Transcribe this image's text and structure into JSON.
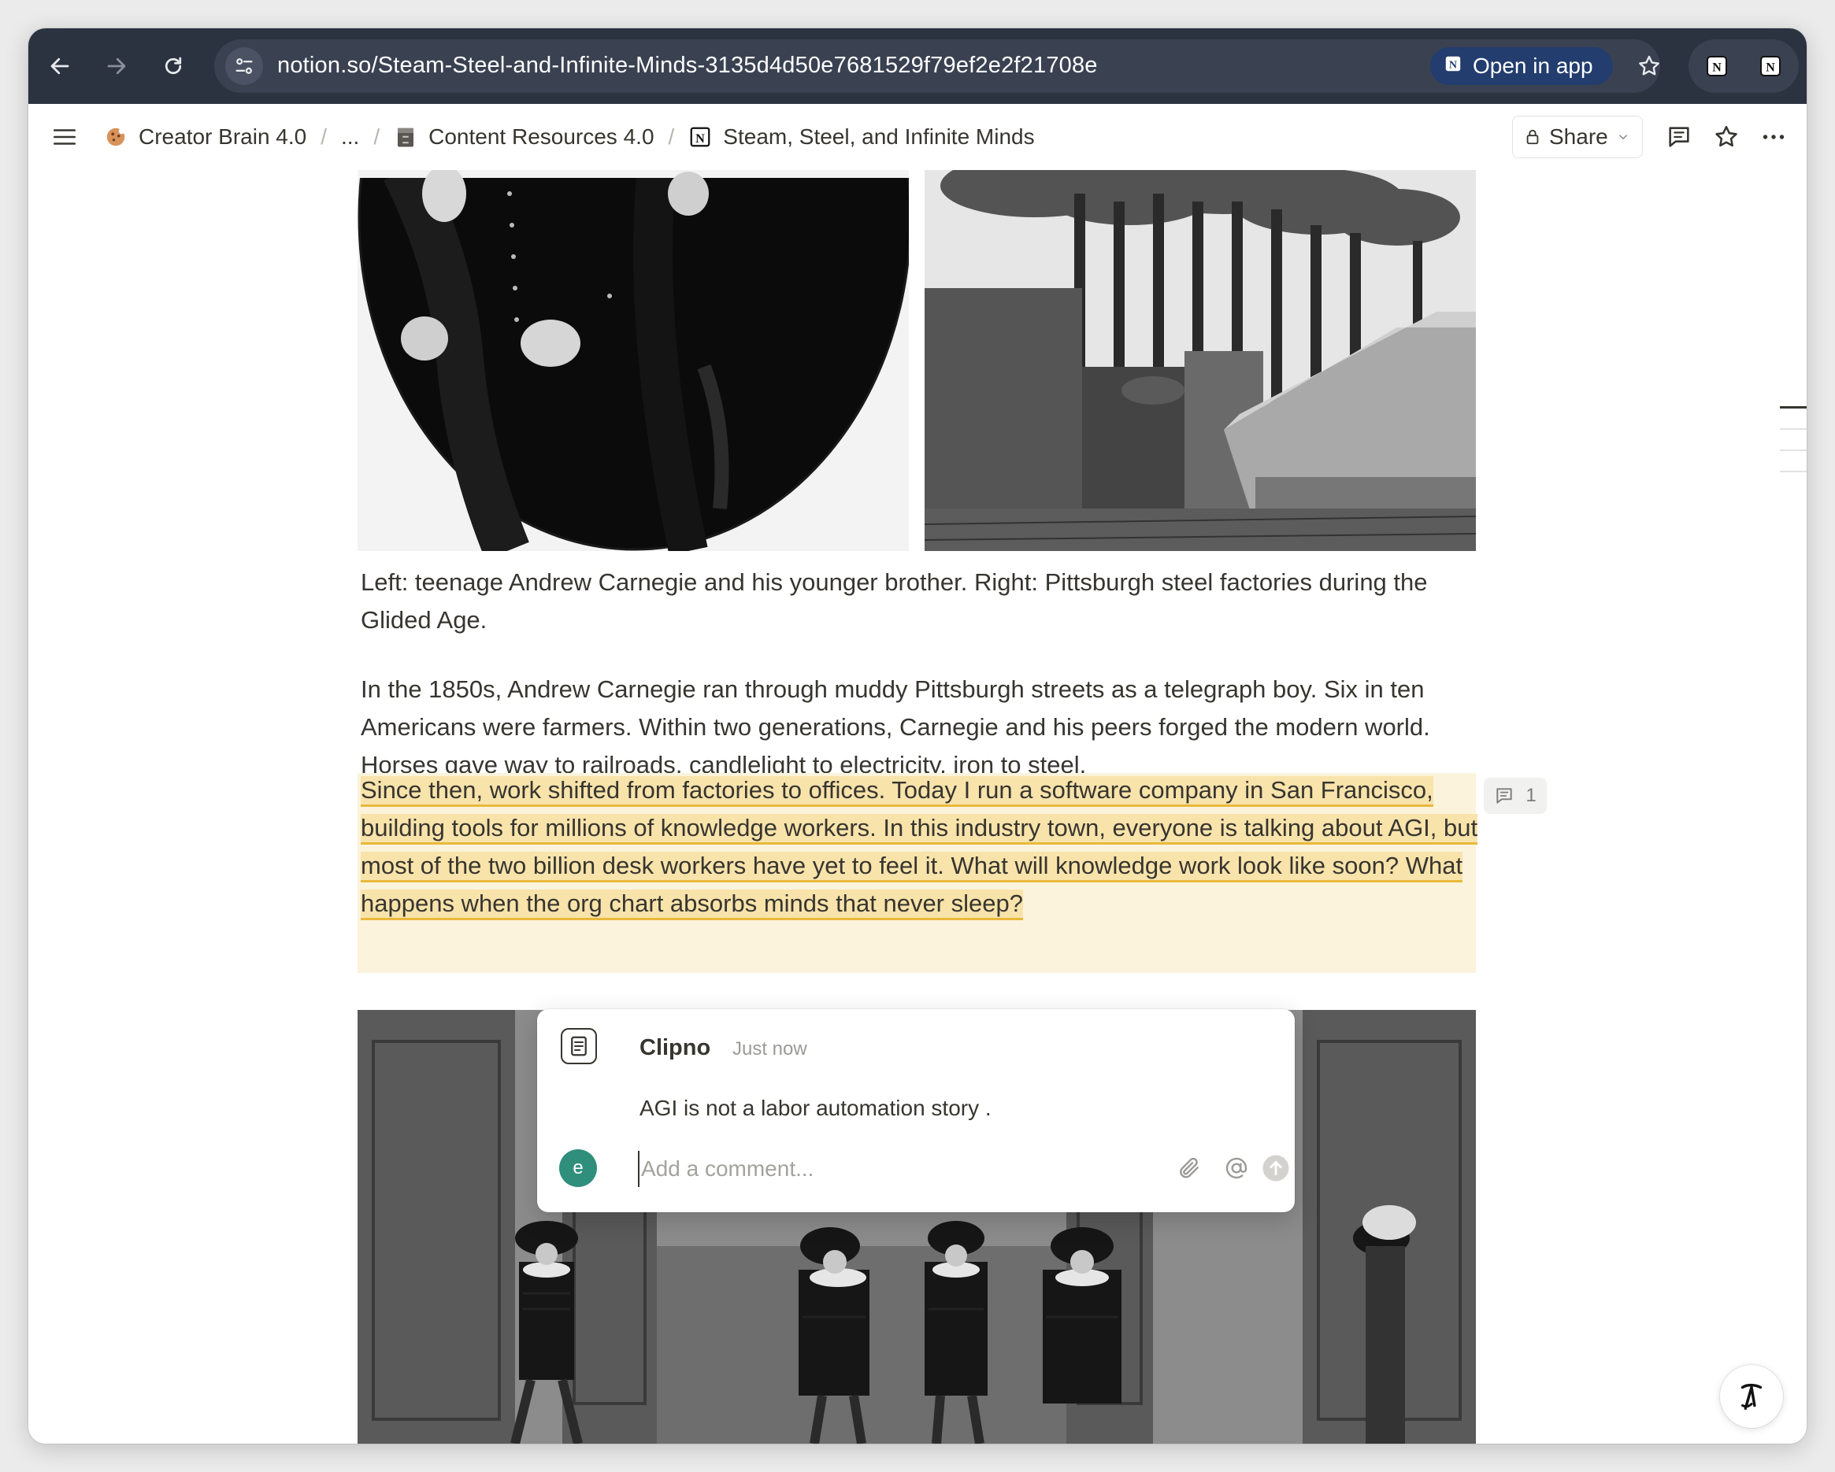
{
  "browser": {
    "url": "notion.so/Steam-Steel-and-Infinite-Minds-3135d4d50e7681529f79ef2e2f21708e",
    "open_in_app_label": "Open in app"
  },
  "topbar": {
    "breadcrumbs": [
      {
        "label": "Creator Brain 4.0",
        "icon": "cookie-icon"
      },
      {
        "label": "...",
        "icon": ""
      },
      {
        "label": "Content Resources 4.0",
        "icon": "file-cabinet-icon"
      },
      {
        "label": "Steam, Steel, and Infinite Minds",
        "icon": "notion-logo-icon"
      }
    ],
    "share_label": "Share"
  },
  "page": {
    "caption": "Left: teenage Andrew Carnegie and his younger brother. Right: Pittsburgh steel factories during the Glided Age.",
    "paragraph_1": "In the 1850s, Andrew Carnegie ran through muddy Pittsburgh streets as a telegraph boy. Six in ten Americans were farmers. Within two generations, Carnegie and his peers forged the modern world. Horses gave way to railroads, candlelight to electricity, iron to steel.",
    "paragraph_2": "Since then, work shifted from factories to offices. Today I run a software company in San Francisco, building tools for millions of knowledge workers. In this industry town, everyone is talking about AGI, but most of the two billion desk workers have yet to feel it. What will knowledge work look like soon? What happens when the org chart absorbs minds that never sleep?",
    "comment_count": "1"
  },
  "comment_popover": {
    "author": "Clipno",
    "time": "Just now",
    "text": "AGI is not a labor automation story .",
    "user_initial": "e",
    "input_placeholder": "Add a comment..."
  },
  "colors": {
    "chrome": "#2b3240",
    "highlight": "#f8e3ab",
    "highlight_underline": "#e9b93c",
    "avatar": "#2f8f7c"
  }
}
